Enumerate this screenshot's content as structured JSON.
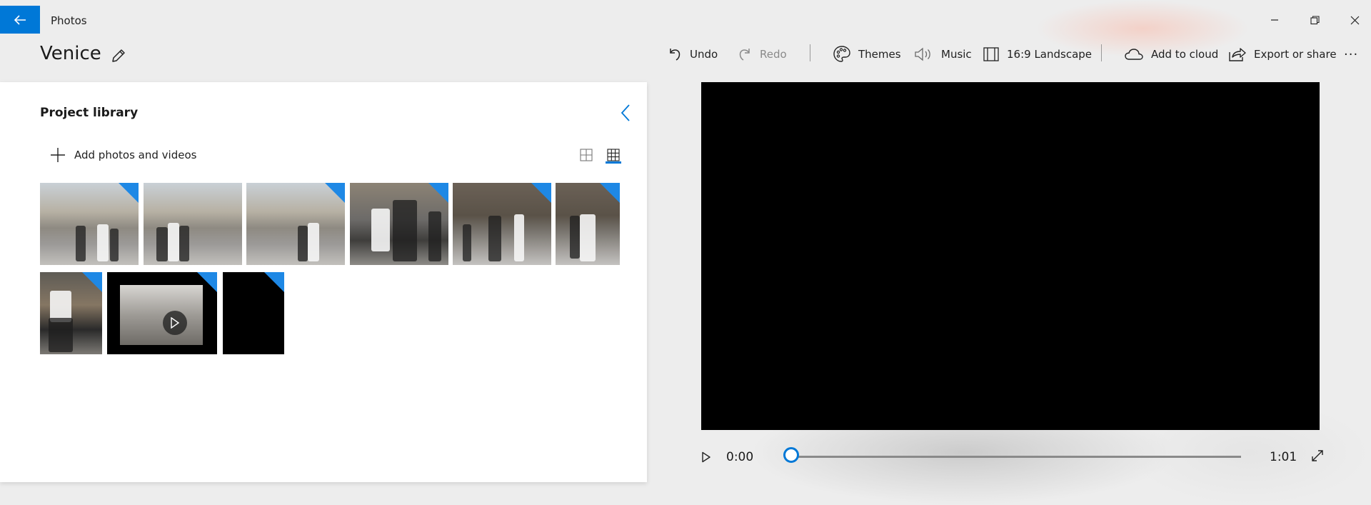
{
  "window": {
    "app_title": "Photos"
  },
  "project": {
    "name": "Venice"
  },
  "toolbar": {
    "undo": "Undo",
    "redo": "Redo",
    "themes": "Themes",
    "music": "Music",
    "aspect": "16:9 Landscape",
    "add_to_cloud": "Add to cloud",
    "export": "Export or share",
    "more": "···"
  },
  "library": {
    "title": "Project library",
    "add_label": "Add photos and videos",
    "view_mode": "grid-small"
  },
  "player": {
    "current_time": "0:00",
    "duration": "1:01",
    "progress": 0
  },
  "colors": {
    "accent": "#0078d7",
    "preview_bg": "#000000"
  }
}
